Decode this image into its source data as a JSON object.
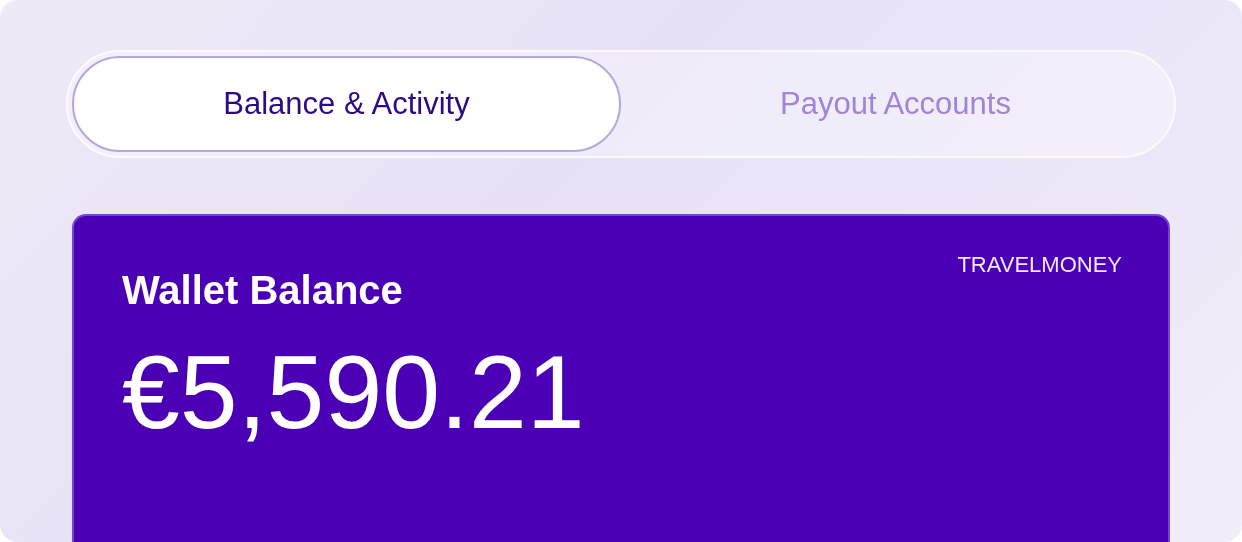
{
  "tabs": [
    {
      "label": "Balance & Activity",
      "selected": true
    },
    {
      "label": "Payout Accounts",
      "selected": false
    }
  ],
  "wallet_card": {
    "title": "Wallet Balance",
    "logo": "TRAVELMONEY",
    "amount": "€5,590.21"
  }
}
